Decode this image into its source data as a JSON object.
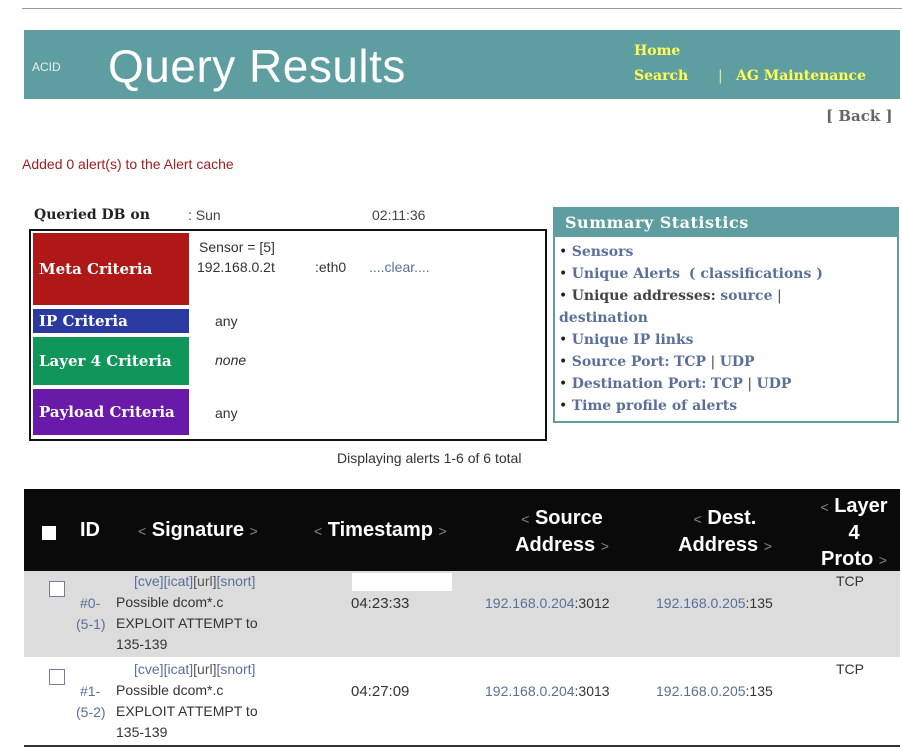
{
  "header": {
    "app_name": "ACID",
    "title": "Query Results",
    "nav_home": "Home",
    "nav_search": "Search",
    "nav_sep": "|",
    "nav_ag": "AG Maintenance",
    "back": "[ Back ]"
  },
  "cache_message": "Added 0 alert(s) to the Alert cache",
  "queried": {
    "label": "Queried DB on",
    "day": ": Sun",
    "time": "02:11:36"
  },
  "criteria": {
    "meta": {
      "label": "Meta Criteria",
      "line1": "Sensor = [5]",
      "ip": "192.168.0.2t",
      "iface": ":eth0",
      "clear": "....clear...."
    },
    "ip": {
      "label": "IP Criteria",
      "value": "any"
    },
    "layer4": {
      "label": "Layer 4 Criteria",
      "value": "none"
    },
    "payload": {
      "label": "Payload Criteria",
      "value": "any"
    }
  },
  "summary": {
    "title": "Summary Statistics",
    "sensors": "Sensors",
    "unique_alerts": "Unique Alerts",
    "classifications": "( classifications )",
    "unique_addresses": "Unique addresses:",
    "source": "source",
    "pipe": "|",
    "destination": "destination",
    "unique_ip_links": "Unique IP links",
    "source_port": "Source Port:",
    "dest_port": "Destination Port:",
    "tcp": "TCP",
    "udp": "UDP",
    "time_profile": "Time profile of alerts"
  },
  "displaying": "Displaying alerts 1-6 of 6 total",
  "table": {
    "col_id": "ID",
    "col_signature": "Signature",
    "col_timestamp": "Timestamp",
    "col_source_1": "Source",
    "col_source_2": "Address",
    "col_dest_1": "Dest.",
    "col_dest_2": "Address",
    "col_layer_1": "Layer",
    "col_layer_2": "4",
    "col_layer_3": "Proto",
    "arrow_left": "<",
    "arrow_right": ">",
    "rows": [
      {
        "ref_cve": "[cve]",
        "ref_icat": "[icat]",
        "ref_url": "[url]",
        "ref_snort": "[snort]",
        "id_a": "#0-",
        "id_b": "(5-1)",
        "sig_1": "Possible dcom*.c",
        "sig_2": "EXPLOIT ATTEMPT to",
        "sig_3": "135-139",
        "timestamp": "04:23:33",
        "src_ip": "192.168.0.204",
        "src_port": ":3012",
        "dst_ip": "192.168.0.205",
        "dst_port": ":135",
        "proto": "TCP"
      },
      {
        "ref_cve": "[cve]",
        "ref_icat": "[icat]",
        "ref_url": "[url]",
        "ref_snort": "[snort]",
        "id_a": "#1-",
        "id_b": "(5-2)",
        "sig_1": "Possible dcom*.c",
        "sig_2": "EXPLOIT ATTEMPT to",
        "sig_3": "135-139",
        "timestamp": "04:27:09",
        "src_ip": "192.168.0.204",
        "src_port": ":3013",
        "dst_ip": "192.168.0.205",
        "dst_port": ":135",
        "proto": "TCP"
      }
    ]
  }
}
